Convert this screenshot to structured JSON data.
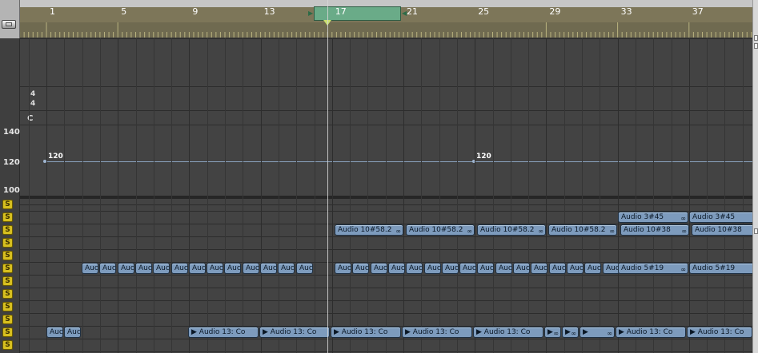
{
  "ruler": {
    "bars": [
      "1",
      "5",
      "9",
      "13",
      "17",
      "21",
      "25",
      "29",
      "33",
      "37"
    ],
    "cycle_start": 17,
    "cycle_end": 21
  },
  "signature": {
    "numerator": "4",
    "denominator": "4",
    "key": "C"
  },
  "tempo": {
    "axis": [
      "140",
      "120",
      "100"
    ],
    "points": [
      {
        "bar": 1,
        "value": "120"
      },
      {
        "bar": 25,
        "value": "120"
      }
    ]
  },
  "solo_label": "S",
  "regions": {
    "lane6": [
      {
        "name": "Audio 3#45",
        "loop": true,
        "start": 33
      },
      {
        "name": "Audio 3#45",
        "loop": true,
        "start": 37
      }
    ],
    "lane7": [
      {
        "name": "Audio 10#58.2",
        "loop": true,
        "start": 17
      },
      {
        "name": "Audio 10#58.2",
        "loop": true,
        "start": 21
      },
      {
        "name": "Audio 10#58.2",
        "loop": true,
        "start": 25
      },
      {
        "name": "Audio 10#58.2",
        "loop": true,
        "start": 29
      },
      {
        "name": "Audio 10#38",
        "loop": true,
        "start": 33
      },
      {
        "name": "Audio 10#38",
        "loop": true,
        "start": 37
      }
    ],
    "lane10_short": "Auc",
    "lane10_long": [
      {
        "name": "Audio 5#19",
        "loop": true,
        "start": 33
      },
      {
        "name": "Audio 5#19",
        "loop": true,
        "start": 37
      }
    ],
    "lane15": {
      "short": "Auc",
      "long": "▶ Audio 13: Co",
      "tiny": "▶"
    }
  }
}
